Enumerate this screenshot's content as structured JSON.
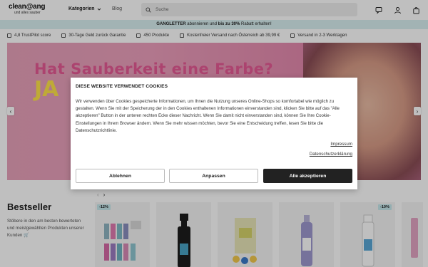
{
  "header": {
    "logo_main": "clean@ang",
    "logo_sub": "und alles sauber",
    "nav_kategorien": "Kategorien",
    "nav_blog": "Blog",
    "search_placeholder": "Suche",
    "icons": [
      "chat-icon",
      "user-icon",
      "bag-icon"
    ]
  },
  "promo": {
    "part1": "GANGLETTER",
    "part2": " abonnieren und ",
    "part3": "bis zu 30%",
    "part4": " Rabatt erhalten!"
  },
  "usps": [
    "4,8 TrustPilot score",
    "30-Tage Geld zurück Garantie",
    "450 Produkte",
    "Kostenfreier Versand nach Österreich ab 39,99 €",
    "Versand in 2-3 Werktagen"
  ],
  "hero": {
    "title": "Hat Sauberkeit eine Farbe?",
    "subtitle": "JA",
    "colors": {
      "pink": "#e65a95",
      "yellow": "#ffe34a"
    }
  },
  "bestseller": {
    "title": "Bestseller",
    "description": "Stöbere in den am besten bewerteten und meistgewählten Produkten unserer Kunden 🛒",
    "badges": [
      "-12%",
      "-10%"
    ]
  },
  "cookie_dialog": {
    "title": "DIESE WEBSITE VERWENDET COOKIES",
    "text": "Wir verwenden über Cookies gespeicherte Informationen, um Ihnen die Nutzung unseres Online-Shops so komfortabel wie möglich zu gestalten. Wenn Sie mit der Speicherung der in den Cookies enthaltenen Informationen einverstanden sind, klicken Sie bitte auf das \"Alle akzeptieren\" Button in der unteren rechten Ecke dieser Nachricht. Wenn Sie damit nicht einverstanden sind, können Sie Ihre Cookie-Einstellungen in Ihrem Browser ändern. Wenn Sie mehr wissen möchten, bevor Sie eine Entscheidung treffen, lesen Sie bitte die Datenschutzrichtlinie.",
    "link_impressum": "Impressum",
    "link_datenschutz": "Datenschutzerklärung",
    "btn_decline": "Ablehnen",
    "btn_customize": "Anpassen",
    "btn_accept": "Alle akzeptieren"
  }
}
